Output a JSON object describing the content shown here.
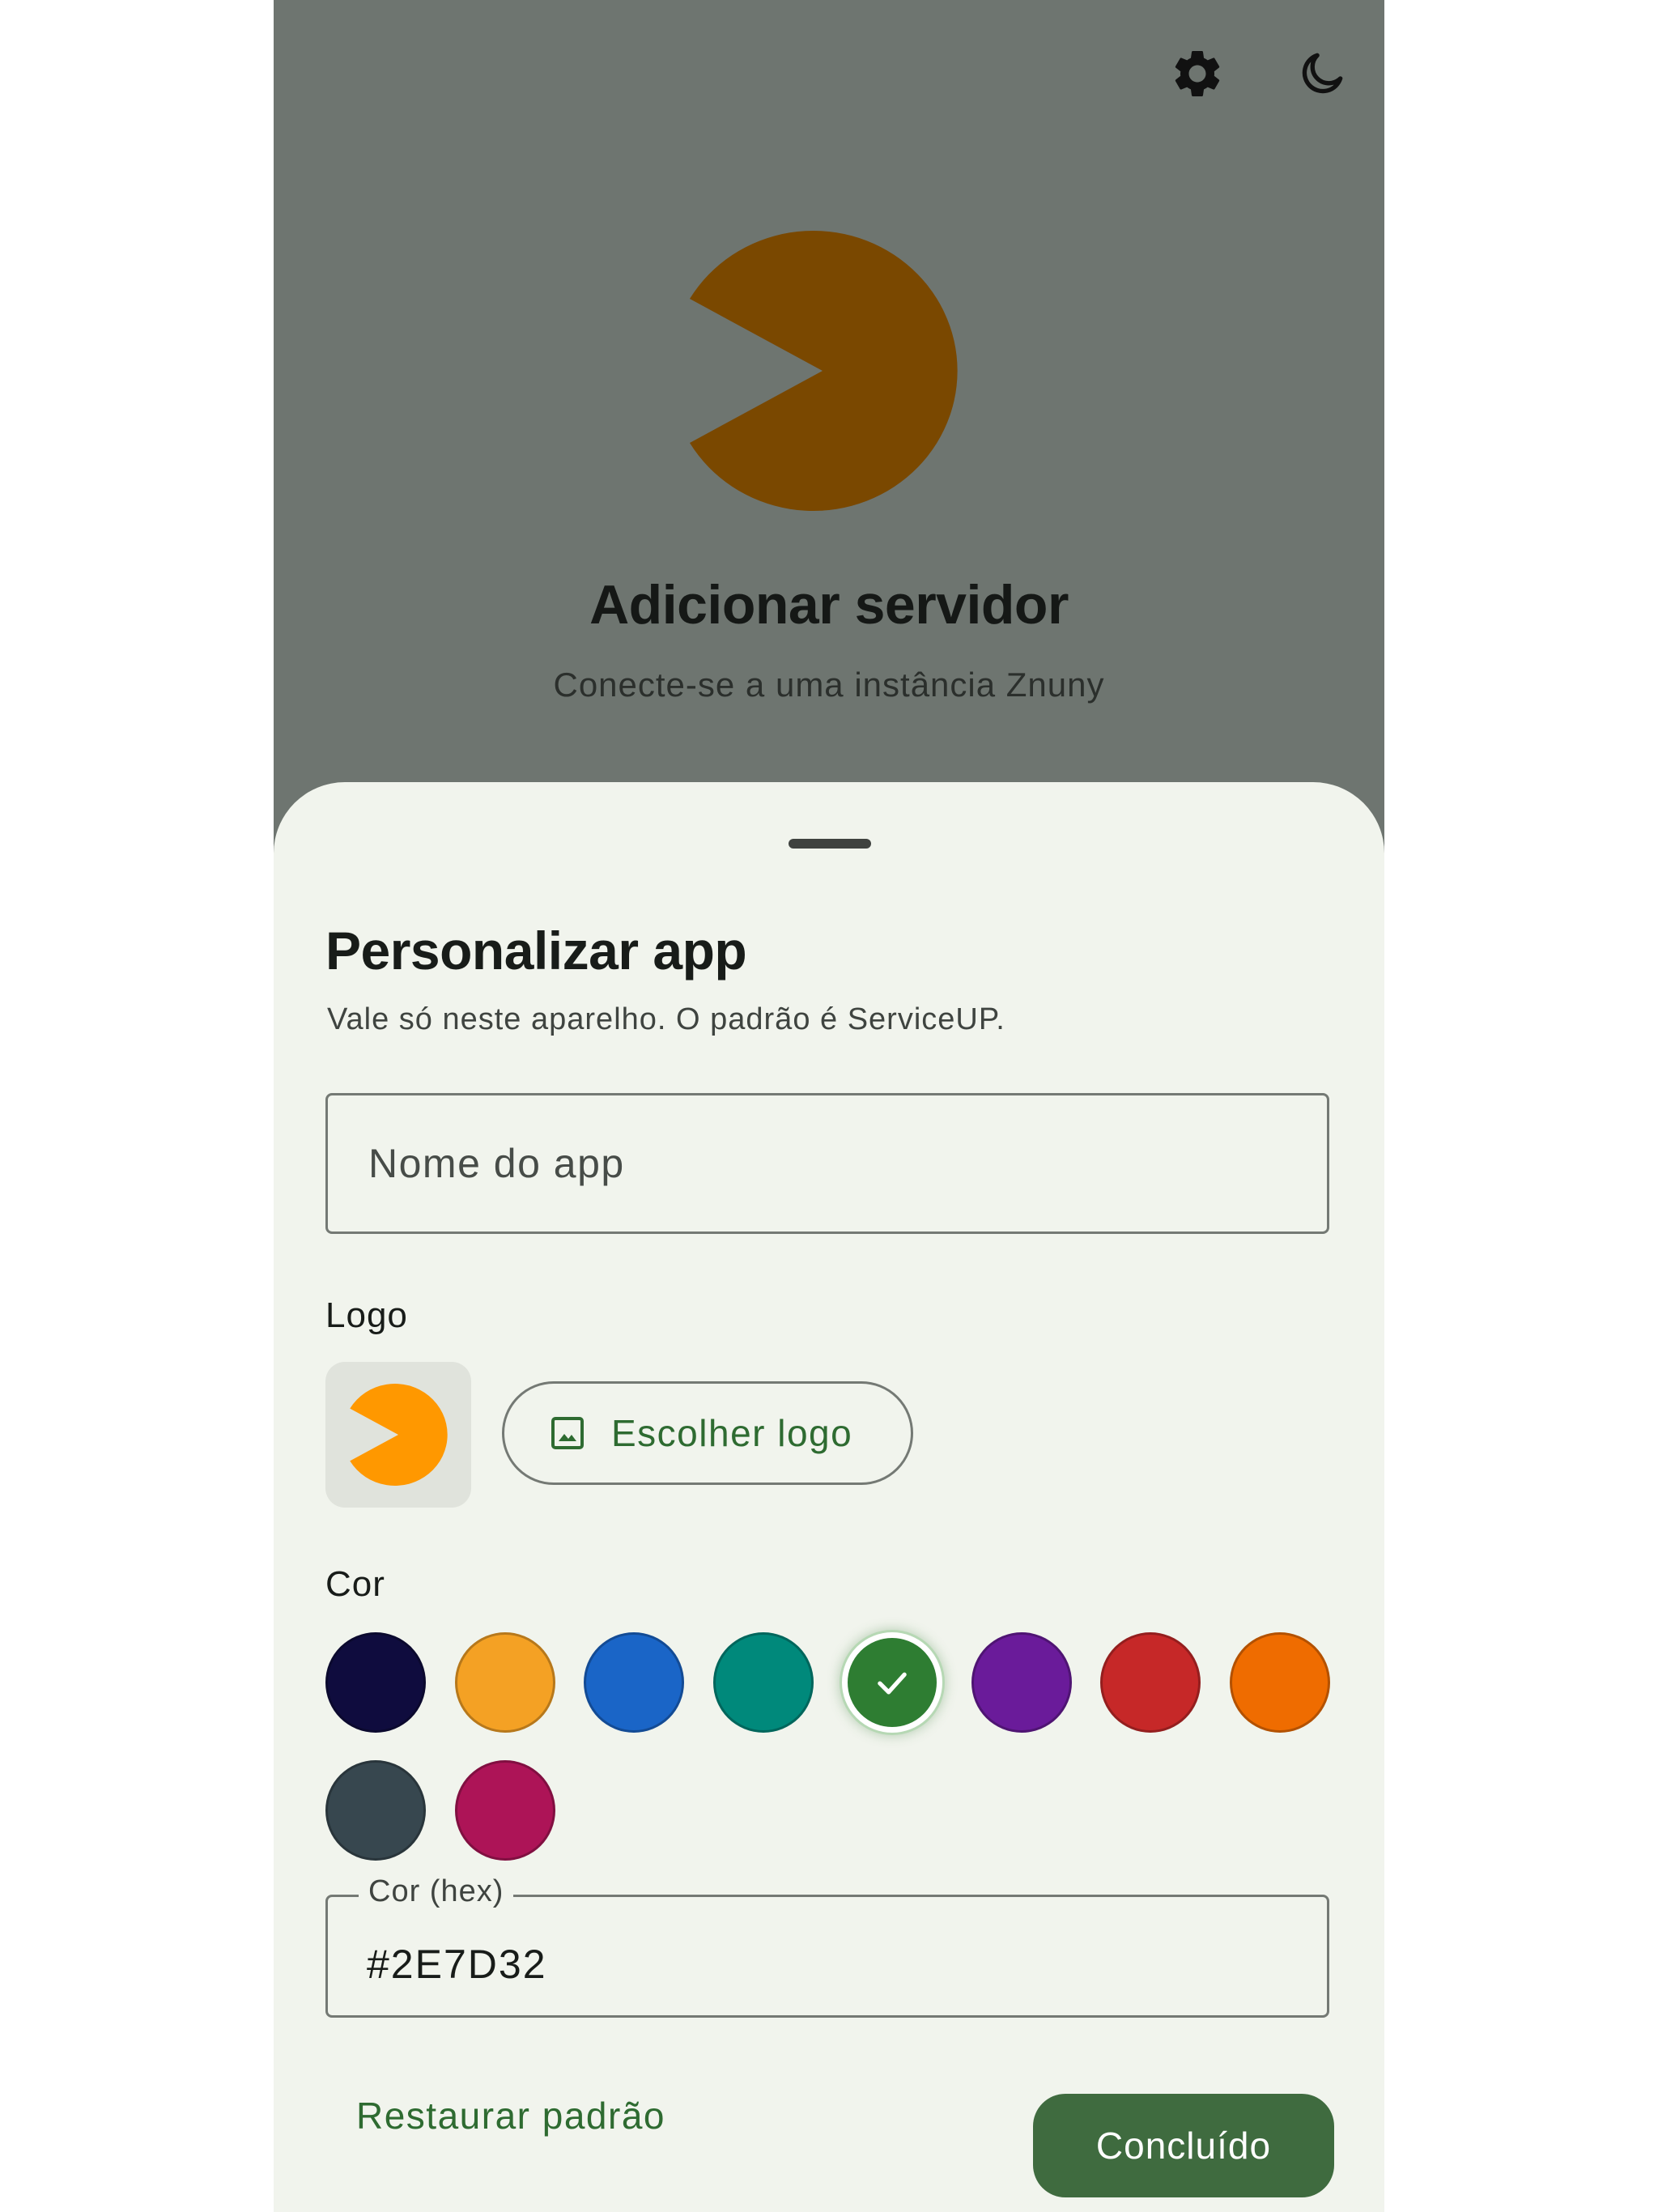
{
  "header": {
    "settings_icon": "gear-icon",
    "theme_icon": "moon-icon",
    "title": "Adicionar servidor",
    "subtitle": "Conecte-se a uma instância Znuny"
  },
  "colors": {
    "backdrop": "#6e7570",
    "hero_logo": "#7a4800",
    "sheet_bg": "#f1f4ed",
    "accent_text": "#2e6b31",
    "primary_button": "#3f6b3f",
    "logo_preview": "#ff9800"
  },
  "sheet": {
    "title": "Personalizar app",
    "subtitle": "Vale só neste aparelho. O padrão é ServiceUP.",
    "name_placeholder": "Nome do app",
    "name_value": "",
    "logo_label": "Logo",
    "choose_logo_label": "Escolher logo",
    "choose_logo_icon": "image-icon",
    "color_label": "Cor",
    "swatches": [
      {
        "color": "#0f0c3e",
        "selected": false
      },
      {
        "color": "#f4a124",
        "selected": false
      },
      {
        "color": "#1a65c7",
        "selected": false
      },
      {
        "color": "#00897b",
        "selected": false
      },
      {
        "color": "#2e7d32",
        "selected": true
      },
      {
        "color": "#6a1b9a",
        "selected": false
      },
      {
        "color": "#c62828",
        "selected": false
      },
      {
        "color": "#ef6c00",
        "selected": false
      },
      {
        "color": "#37474f",
        "selected": false
      },
      {
        "color": "#ad1457",
        "selected": false
      }
    ],
    "hex_label": "Cor (hex)",
    "hex_value": "#2E7D32",
    "restore_label": "Restaurar padrão",
    "done_label": "Concluído"
  }
}
